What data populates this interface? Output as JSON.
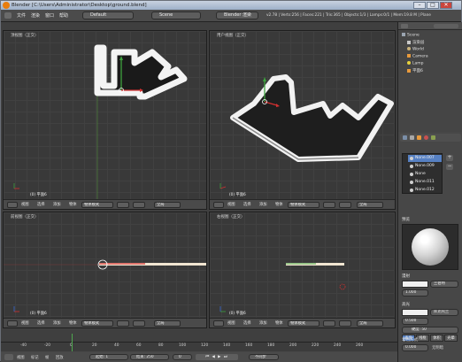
{
  "titlebar": {
    "title": "Blender [C:\\Users\\Administrator\\Desktop\\ground.blend]"
  },
  "window_buttons": [
    "–",
    "□",
    "✕"
  ],
  "menus": [
    "文件",
    "渲染",
    "窗口",
    "帮助"
  ],
  "header": {
    "layout": "Default",
    "scene": "Scene",
    "engine": "Blender 渲染",
    "stats": "v2.78 | Verts:256 | Faces:221 | Tris:365 | Objects:1/3 | Lamps:0/1 | Mem:19.8 M | Plane"
  },
  "viewports": [
    {
      "label": "顶视图（正交）",
      "object": "(0) 平面6"
    },
    {
      "label": "用户视图（正交）",
      "object": "(0) 平面6"
    },
    {
      "label": "前视图（正交）",
      "object": "(0) 平面6"
    },
    {
      "label": "右视图（正交）",
      "object": "(0) 平面6"
    }
  ],
  "viewport_footer": {
    "view": "视图",
    "select": "选择",
    "add": "添加",
    "object": "物体",
    "mode": "物体模式",
    "global": "全局"
  },
  "outliner": {
    "items": [
      {
        "label": "Scene",
        "color": "#9aa4b0"
      },
      {
        "label": "渲染层",
        "color": "#c8c8c8"
      },
      {
        "label": "World",
        "color": "#c9b27a"
      },
      {
        "label": "Camera",
        "color": "#e89a3c"
      },
      {
        "label": "Lamp",
        "color": "#e8d23c"
      },
      {
        "label": "平面6",
        "color": "#e89a3c"
      }
    ]
  },
  "materials": {
    "slots": [
      "None.007",
      "None.009",
      "None",
      "None.011",
      "None.012"
    ],
    "tabs": [
      "表面",
      "线框",
      "体积",
      "光晕"
    ]
  },
  "properties": {
    "preview": "预览",
    "diffuse": "漫射",
    "diffuse_shader": "兰伯特",
    "diffuse_intensity": "1.000",
    "specular": "高光",
    "specular_shader": "库克托兰",
    "specular_intensity": "0.500",
    "hardness": "硬度: 50",
    "shading": "着色方式",
    "emit": "0.000",
    "shadeless": "无明暗"
  },
  "timeline": {
    "ticks": [
      "-40",
      "-20",
      "0",
      "20",
      "40",
      "60",
      "80",
      "100",
      "120",
      "140",
      "160",
      "180",
      "200",
      "220",
      "240",
      "260"
    ],
    "view": "视图",
    "marker": "标记",
    "frame": "帧",
    "playback": "回放",
    "start": "起始: 1",
    "end": "结束: 250",
    "current": "0",
    "sync": "不同步"
  },
  "colors": {
    "accent": "#e87d0d",
    "selected": "#5680c2",
    "outline": "#f0a030"
  }
}
